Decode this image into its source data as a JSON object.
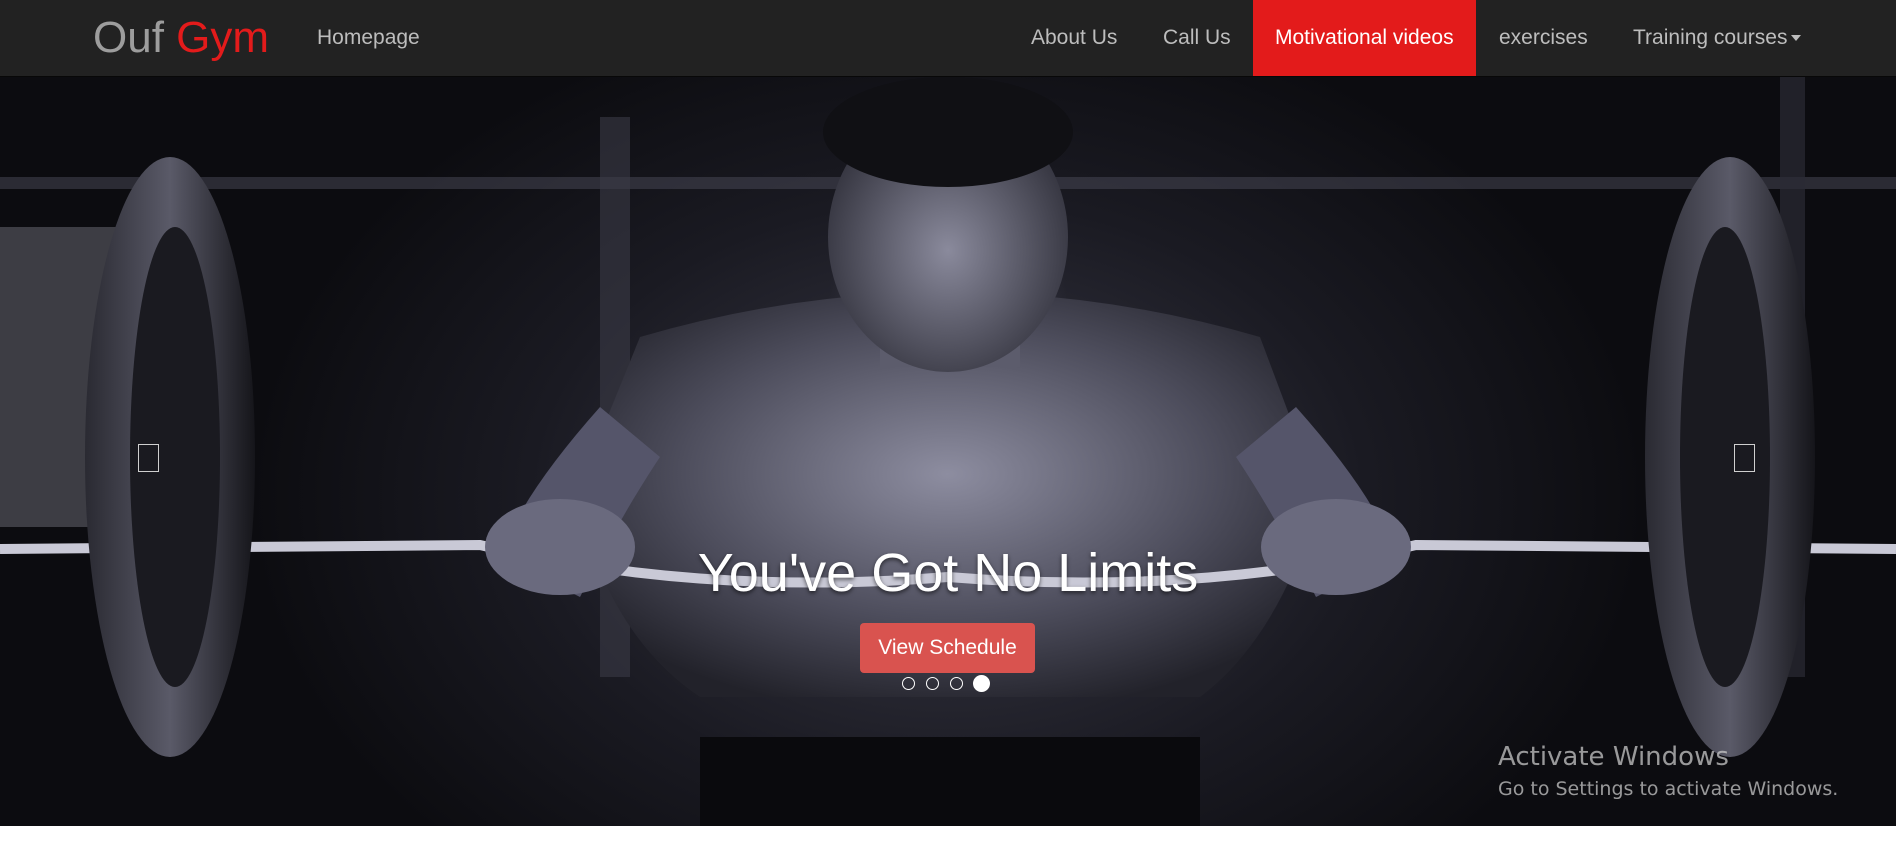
{
  "navbar": {
    "brand_part1": "Ouf",
    "brand_part2": "Gym",
    "brand_accent_color": "#e31b1b",
    "left_links": [
      "Homepage"
    ],
    "right_links": [
      {
        "label": "About Us",
        "active": false
      },
      {
        "label": "Call Us",
        "active": false
      },
      {
        "label": "Motivational videos",
        "active": true
      },
      {
        "label": "exercises",
        "active": false
      },
      {
        "label": "Training courses",
        "active": false,
        "dropdown": true
      }
    ]
  },
  "hero": {
    "image_description_icon": "barbell-curl-photo",
    "title": "You've Got No Limits",
    "cta_label": "View Schedule",
    "cta_color": "#d9534f",
    "slide_count": 4,
    "active_slide": 4,
    "prev_control_icon": "chevron-left-icon",
    "next_control_icon": "chevron-right-icon"
  },
  "watermark": {
    "title": "Activate Windows",
    "subtitle": "Go to Settings to activate Windows."
  }
}
